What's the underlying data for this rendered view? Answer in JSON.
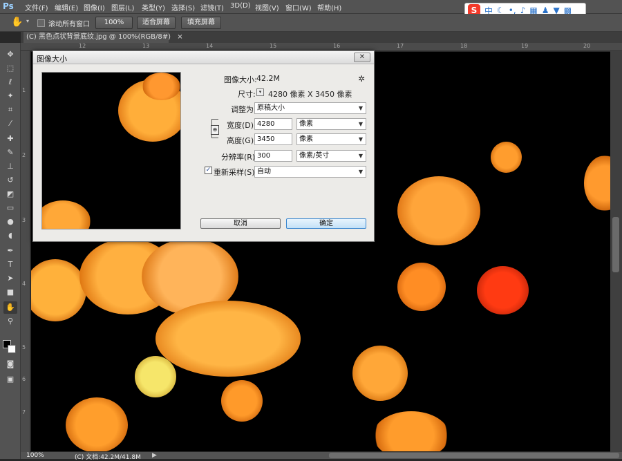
{
  "app": {
    "logo": "Ps"
  },
  "menu": [
    "文件(F)",
    "编辑(E)",
    "图像(I)",
    "图层(L)",
    "类型(Y)",
    "选择(S)",
    "滤镜(T)",
    "3D(D)",
    "视图(V)",
    "窗口(W)",
    "帮助(H)"
  ],
  "ime": {
    "logo": "S",
    "mode": "中",
    "icons": [
      "moon-icon",
      "dot-icon",
      "mic-icon",
      "keyboard-icon",
      "user-icon",
      "shirt-icon",
      "grid-icon"
    ]
  },
  "options": {
    "scroll_all_label": "滚动所有窗口",
    "zoom_button": "100%",
    "fit_screen_button": "适合屏幕",
    "fill_screen_button": "填充屏幕"
  },
  "document": {
    "tab_title": "(C) 黑色点状背景底纹.jpg @ 100%(RGB/8#)",
    "tab_close": "×"
  },
  "ruler": {
    "top_labels": [
      "12",
      "13",
      "14",
      "15",
      "16",
      "17",
      "18",
      "19",
      "20"
    ],
    "left_labels": [
      "1",
      "2",
      "3",
      "4",
      "5",
      "6",
      "7"
    ]
  },
  "status": {
    "zoom": "100%",
    "doc_info": "(C) 文档:42.2M/41.8M",
    "arrow": "▶"
  },
  "dialog": {
    "title": "图像大小",
    "close": "✕",
    "image_size_label": "图像大小:",
    "image_size_value": "42.2M",
    "gear": "✲",
    "dimensions_label": "尺寸:",
    "dimensions_value": "4280 像素  X  3450 像素",
    "fit_to_label": "调整为:",
    "fit_to_value": "原稿大小",
    "width_label": "宽度(D):",
    "width_value": "4280",
    "width_unit": "像素",
    "height_label": "高度(G):",
    "height_value": "3450",
    "height_unit": "像素",
    "resolution_label": "分辨率(R):",
    "resolution_value": "300",
    "resolution_unit": "像素/英寸",
    "resample_label": "重新采样(S):",
    "resample_checked": true,
    "resample_value": "自动",
    "cancel_button": "取消",
    "ok_button": "确定"
  },
  "colors": {
    "accent": "#3a86cf",
    "canvas_bg": "#000000",
    "ui_bg": "#535353"
  }
}
